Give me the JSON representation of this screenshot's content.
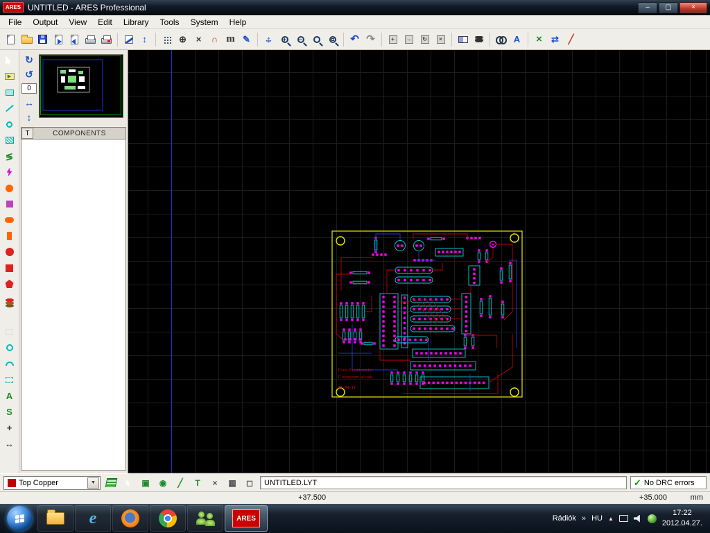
{
  "window": {
    "title": "UNTITLED - ARES Professional",
    "app_badge": "ARES",
    "minimize_glyph": "–",
    "maximize_glyph": "▢",
    "close_glyph": "×"
  },
  "menu": {
    "items": [
      "File",
      "Output",
      "View",
      "Edit",
      "Library",
      "Tools",
      "System",
      "Help"
    ]
  },
  "icons": {
    "metric": "m",
    "undo": "↶",
    "redo": "↷",
    "pan_h": "↔",
    "pan_v": "↕",
    "zoom_in": "+",
    "zoom_out": "−",
    "rotate_cw": "↻",
    "rotate_ccw": "↺",
    "mirror_h": "↔",
    "mirror_v": "↕",
    "origin": "⊕",
    "x_cursor": "×",
    "snap": "∩",
    "flip": "↕",
    "goto": "✎",
    "auto_name": "A",
    "auto_route": "×",
    "ratsnest_recalc": "⇄",
    "drc_slope": "╱",
    "component_play": "▶",
    "rats_mode": "≶",
    "text_tool": "A",
    "symbol_tool": "S",
    "marker_tool": "+",
    "dimension_tool": "↔",
    "mode_square": "▣",
    "mode_target": "◉",
    "mode_trace": "╱",
    "mode_text": "T",
    "mode_cross": "×",
    "mode_grid": "▦",
    "mode_box": "◻",
    "dropdown_arrow": "▼"
  },
  "rotation": {
    "angle": "0"
  },
  "components_panel": {
    "toggle": "T",
    "header": "COMPONENTS"
  },
  "layerbar": {
    "selected_layer": "Top Copper",
    "filename": "UNTITLED.LYT",
    "drc_check": "✓",
    "drc_text": "No DRC errors"
  },
  "coordbar": {
    "x": "+37.500",
    "y": "+35.000",
    "units": "mm"
  },
  "pcb": {
    "silk_lines": [
      "Tisa-Electronic",
      "T eshuoam alnak",
      "dE-B4-1T"
    ]
  },
  "taskbar": {
    "tray_label": "Rádiók",
    "chevron": "»",
    "language": "HU",
    "hidden_icons": "▲",
    "time": "17:22",
    "date": "2012.04.27."
  }
}
